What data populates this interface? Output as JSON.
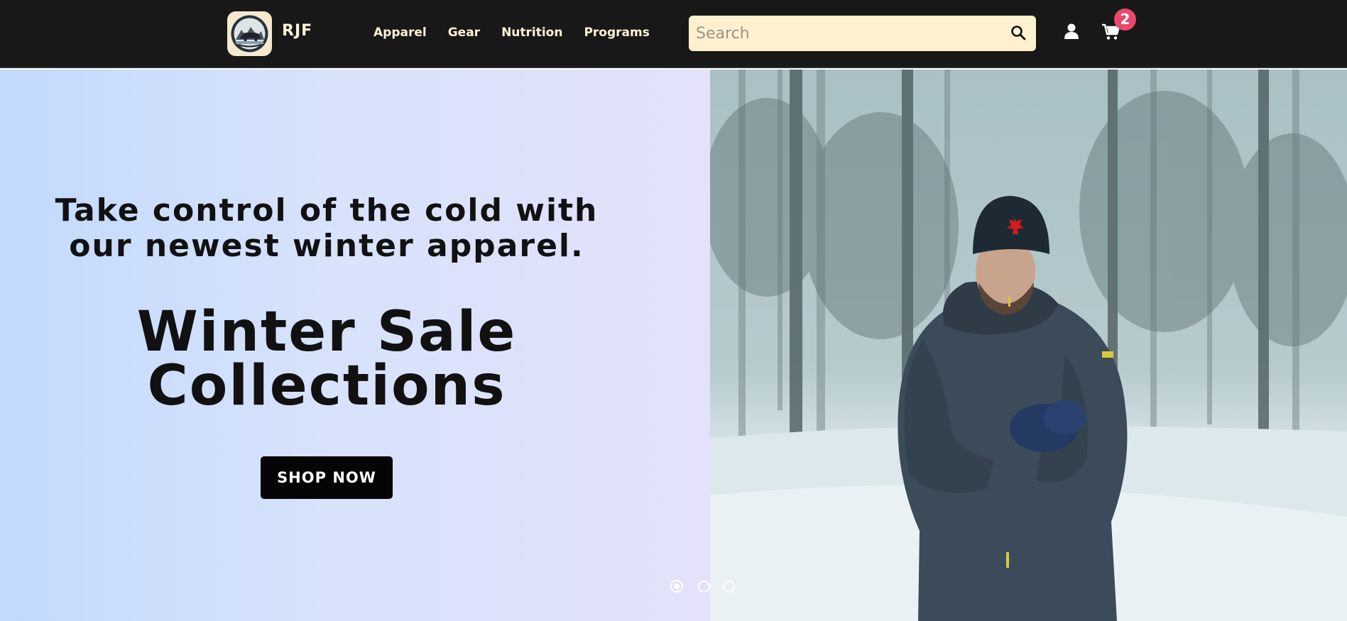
{
  "brand": {
    "name": "RJF",
    "logo": "bear-logo-icon"
  },
  "nav": {
    "links": [
      "Apparel",
      "Gear",
      "Nutrition",
      "Programs"
    ]
  },
  "search": {
    "placeholder": "Search",
    "value": "",
    "icon": "search-icon"
  },
  "account": {
    "icon": "user-icon"
  },
  "cart": {
    "icon": "cart-icon",
    "count": "2"
  },
  "hero": {
    "tagline": "Take control of the cold with our newest winter apparel.",
    "title": "Winter Sale Collections",
    "cta": "SHOP NOW",
    "slides_total": 3,
    "active_slide": 1
  },
  "colors": {
    "navbar": "#181818",
    "nav_text": "#fff3d6",
    "search_bg": "#fff1cf",
    "badge": "#e8496b",
    "cta_bg": "#050505"
  }
}
